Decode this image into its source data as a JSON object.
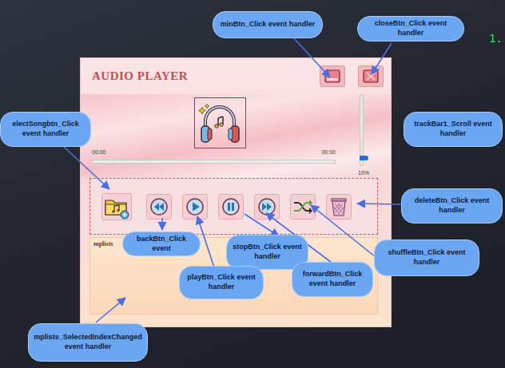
{
  "corner_text": "1.",
  "player": {
    "title": "AUDIO PLAYER",
    "time_elapsed": "00:00",
    "time_total": "00:00",
    "progress": {
      "level": 0
    },
    "volume": {
      "level": 0.1,
      "reading": "10%"
    },
    "playlist": {
      "label": "mplists",
      "items": []
    }
  },
  "callouts": [
    {
      "text": "minBtn_Click event handler"
    },
    {
      "text": "closeBtn_Click event handler"
    },
    {
      "text": "electSongbtn_Click event handler"
    },
    {
      "text": "trackBar1_Scroll event handler"
    },
    {
      "text": "deleteBtn_Click event handler"
    },
    {
      "text": "backBtn_Click event"
    },
    {
      "text": "stopBtn_Click event handler"
    },
    {
      "text": "shuffleBtn_Click event handler"
    },
    {
      "text": "playBtn_Click event handler"
    },
    {
      "text": "forwardBtn_Click event handler"
    },
    {
      "text": "mplists_SelectedIndexChanged event handler"
    }
  ]
}
